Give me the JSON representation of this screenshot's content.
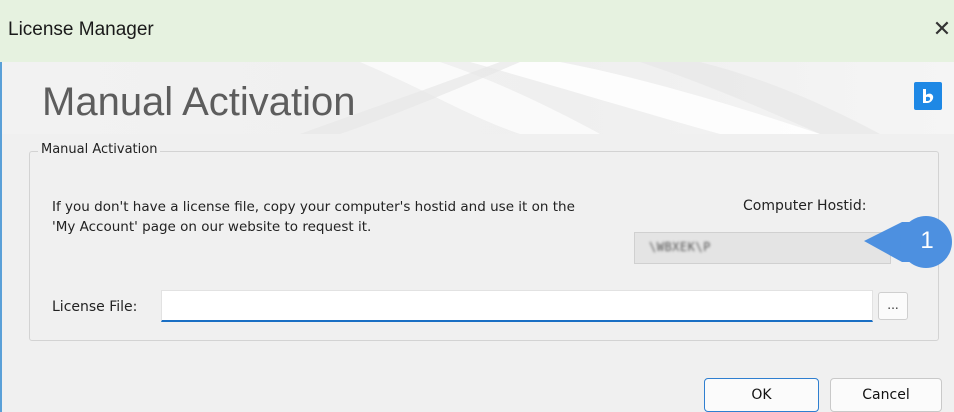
{
  "window": {
    "title": "License Manager",
    "close_glyph": "✕",
    "close_icon": "close-icon"
  },
  "banner": {
    "title": "Manual Activation",
    "logo_icon": "app-logo-icon",
    "logo_color": "#1e88e5"
  },
  "group": {
    "legend": "Manual Activation",
    "description": "If you don't have a license file, copy your computer's hostid and use it on the 'My Account' page on our website to request it.",
    "hostid_label": "Computer Hostid:",
    "hostid_value": "\\WBXEK\\P",
    "license_file_label": "License File:",
    "license_file_value": "",
    "browse_label": "..."
  },
  "callout": {
    "number": "1",
    "color": "#4d90e0"
  },
  "footer": {
    "ok_label": "OK",
    "cancel_label": "Cancel",
    "accent": "#2f7fd0"
  }
}
